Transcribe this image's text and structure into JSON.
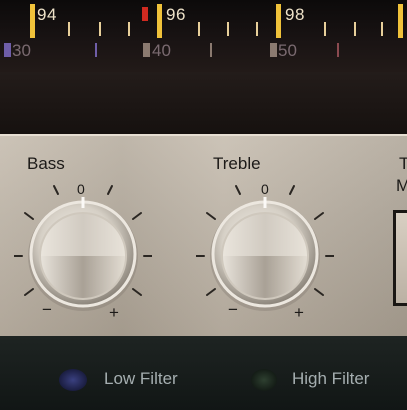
{
  "dial": {
    "fm_labels": [
      "94",
      "96",
      "98"
    ],
    "am_labels": [
      "30",
      "40",
      "50"
    ]
  },
  "controls": {
    "bass": {
      "label": "Bass",
      "center": "0",
      "minus": "−",
      "plus": "+"
    },
    "treble": {
      "label": "Treble",
      "center": "0",
      "minus": "−",
      "plus": "+"
    },
    "next_label_top": "T",
    "next_label_bottom": "M"
  },
  "switches": {
    "low_filter": "Low Filter",
    "high_filter": "High Filter"
  },
  "colors": {
    "panel": "#c0b7aa",
    "strip": "#161b1a",
    "dial_tick": "#f0c23a",
    "dial_marker": "#d02a20",
    "low_led": "#252a5a",
    "high_led": "#1f2f22"
  }
}
